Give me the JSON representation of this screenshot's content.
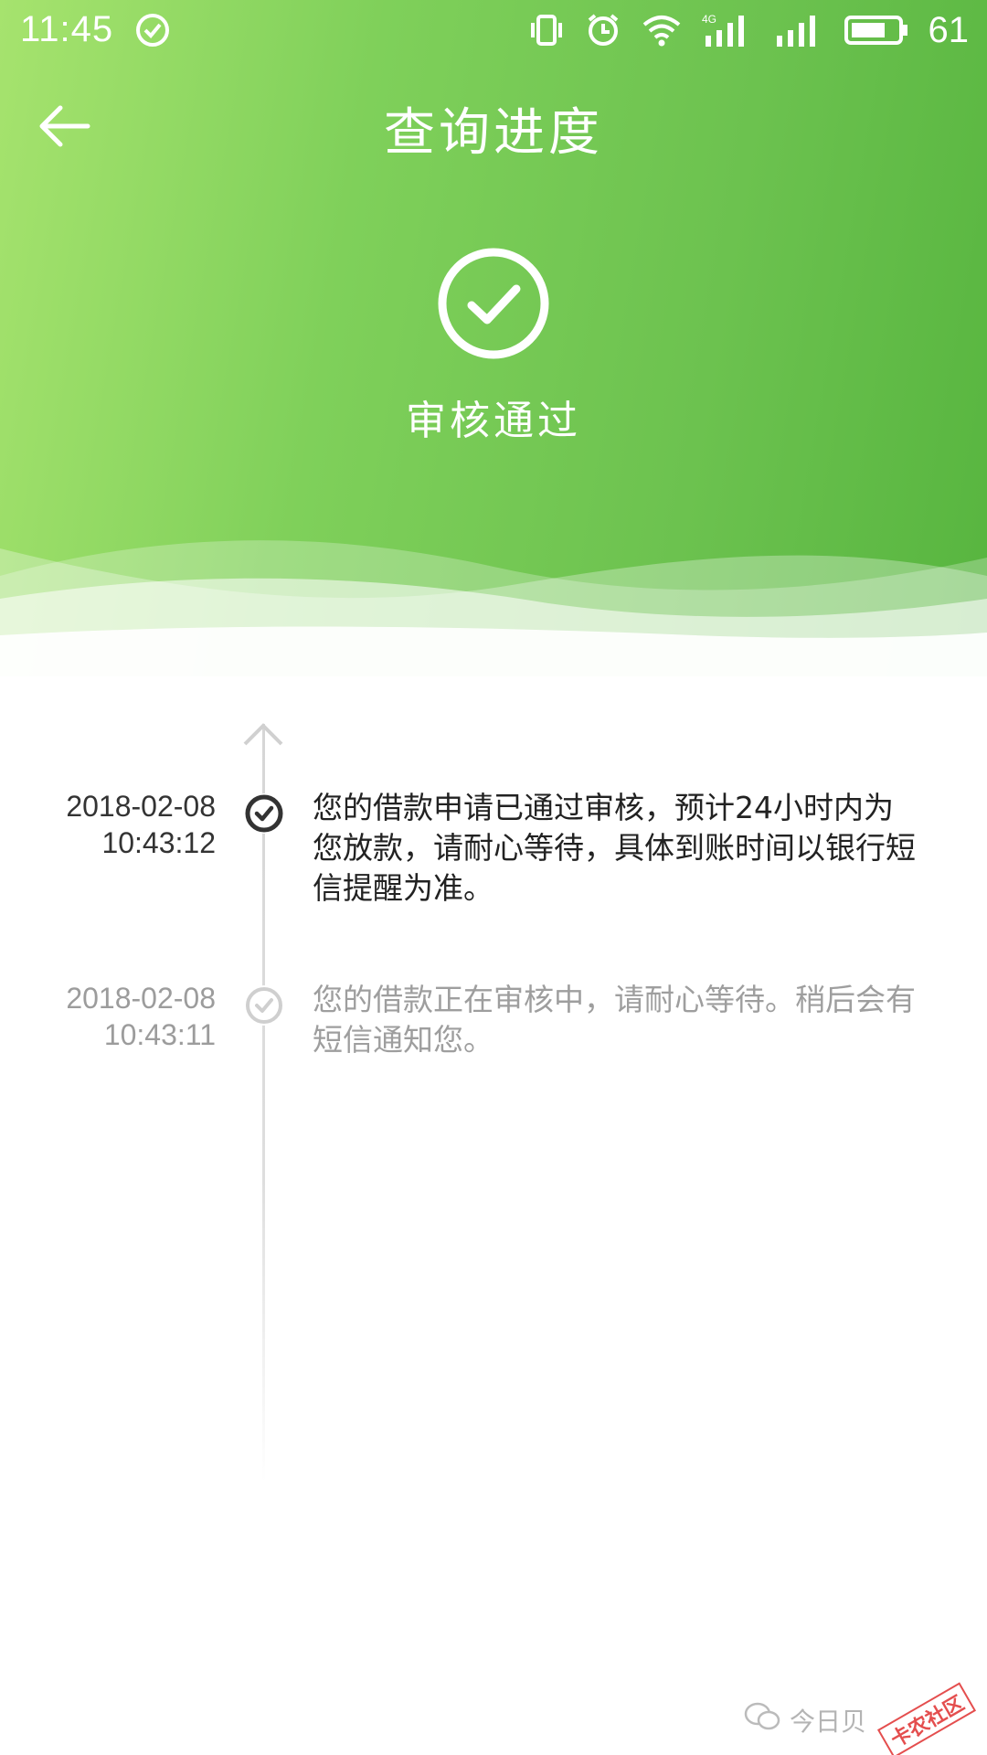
{
  "status_bar": {
    "time": "11:45",
    "battery": "61",
    "network": "4G"
  },
  "header": {
    "title": "查询进度",
    "status_text": "审核通过"
  },
  "timeline": [
    {
      "date": "2018-02-08",
      "time": "10:43:12",
      "text": "您的借款申请已通过审核，预计24小时内为您放款，请耐心等待，具体到账时间以银行短信提醒为准。",
      "state": "current"
    },
    {
      "date": "2018-02-08",
      "time": "10:43:11",
      "text": "您的借款正在审核中，请耐心等待。稍后会有短信通知您。",
      "state": "past"
    }
  ],
  "watermark": {
    "text": "今日贝",
    "badge": "卡农社区"
  },
  "colors": {
    "header_start": "#a6e36e",
    "header_end": "#57b53f",
    "active_node": "#333333",
    "inactive_node": "#c8c8c8"
  }
}
